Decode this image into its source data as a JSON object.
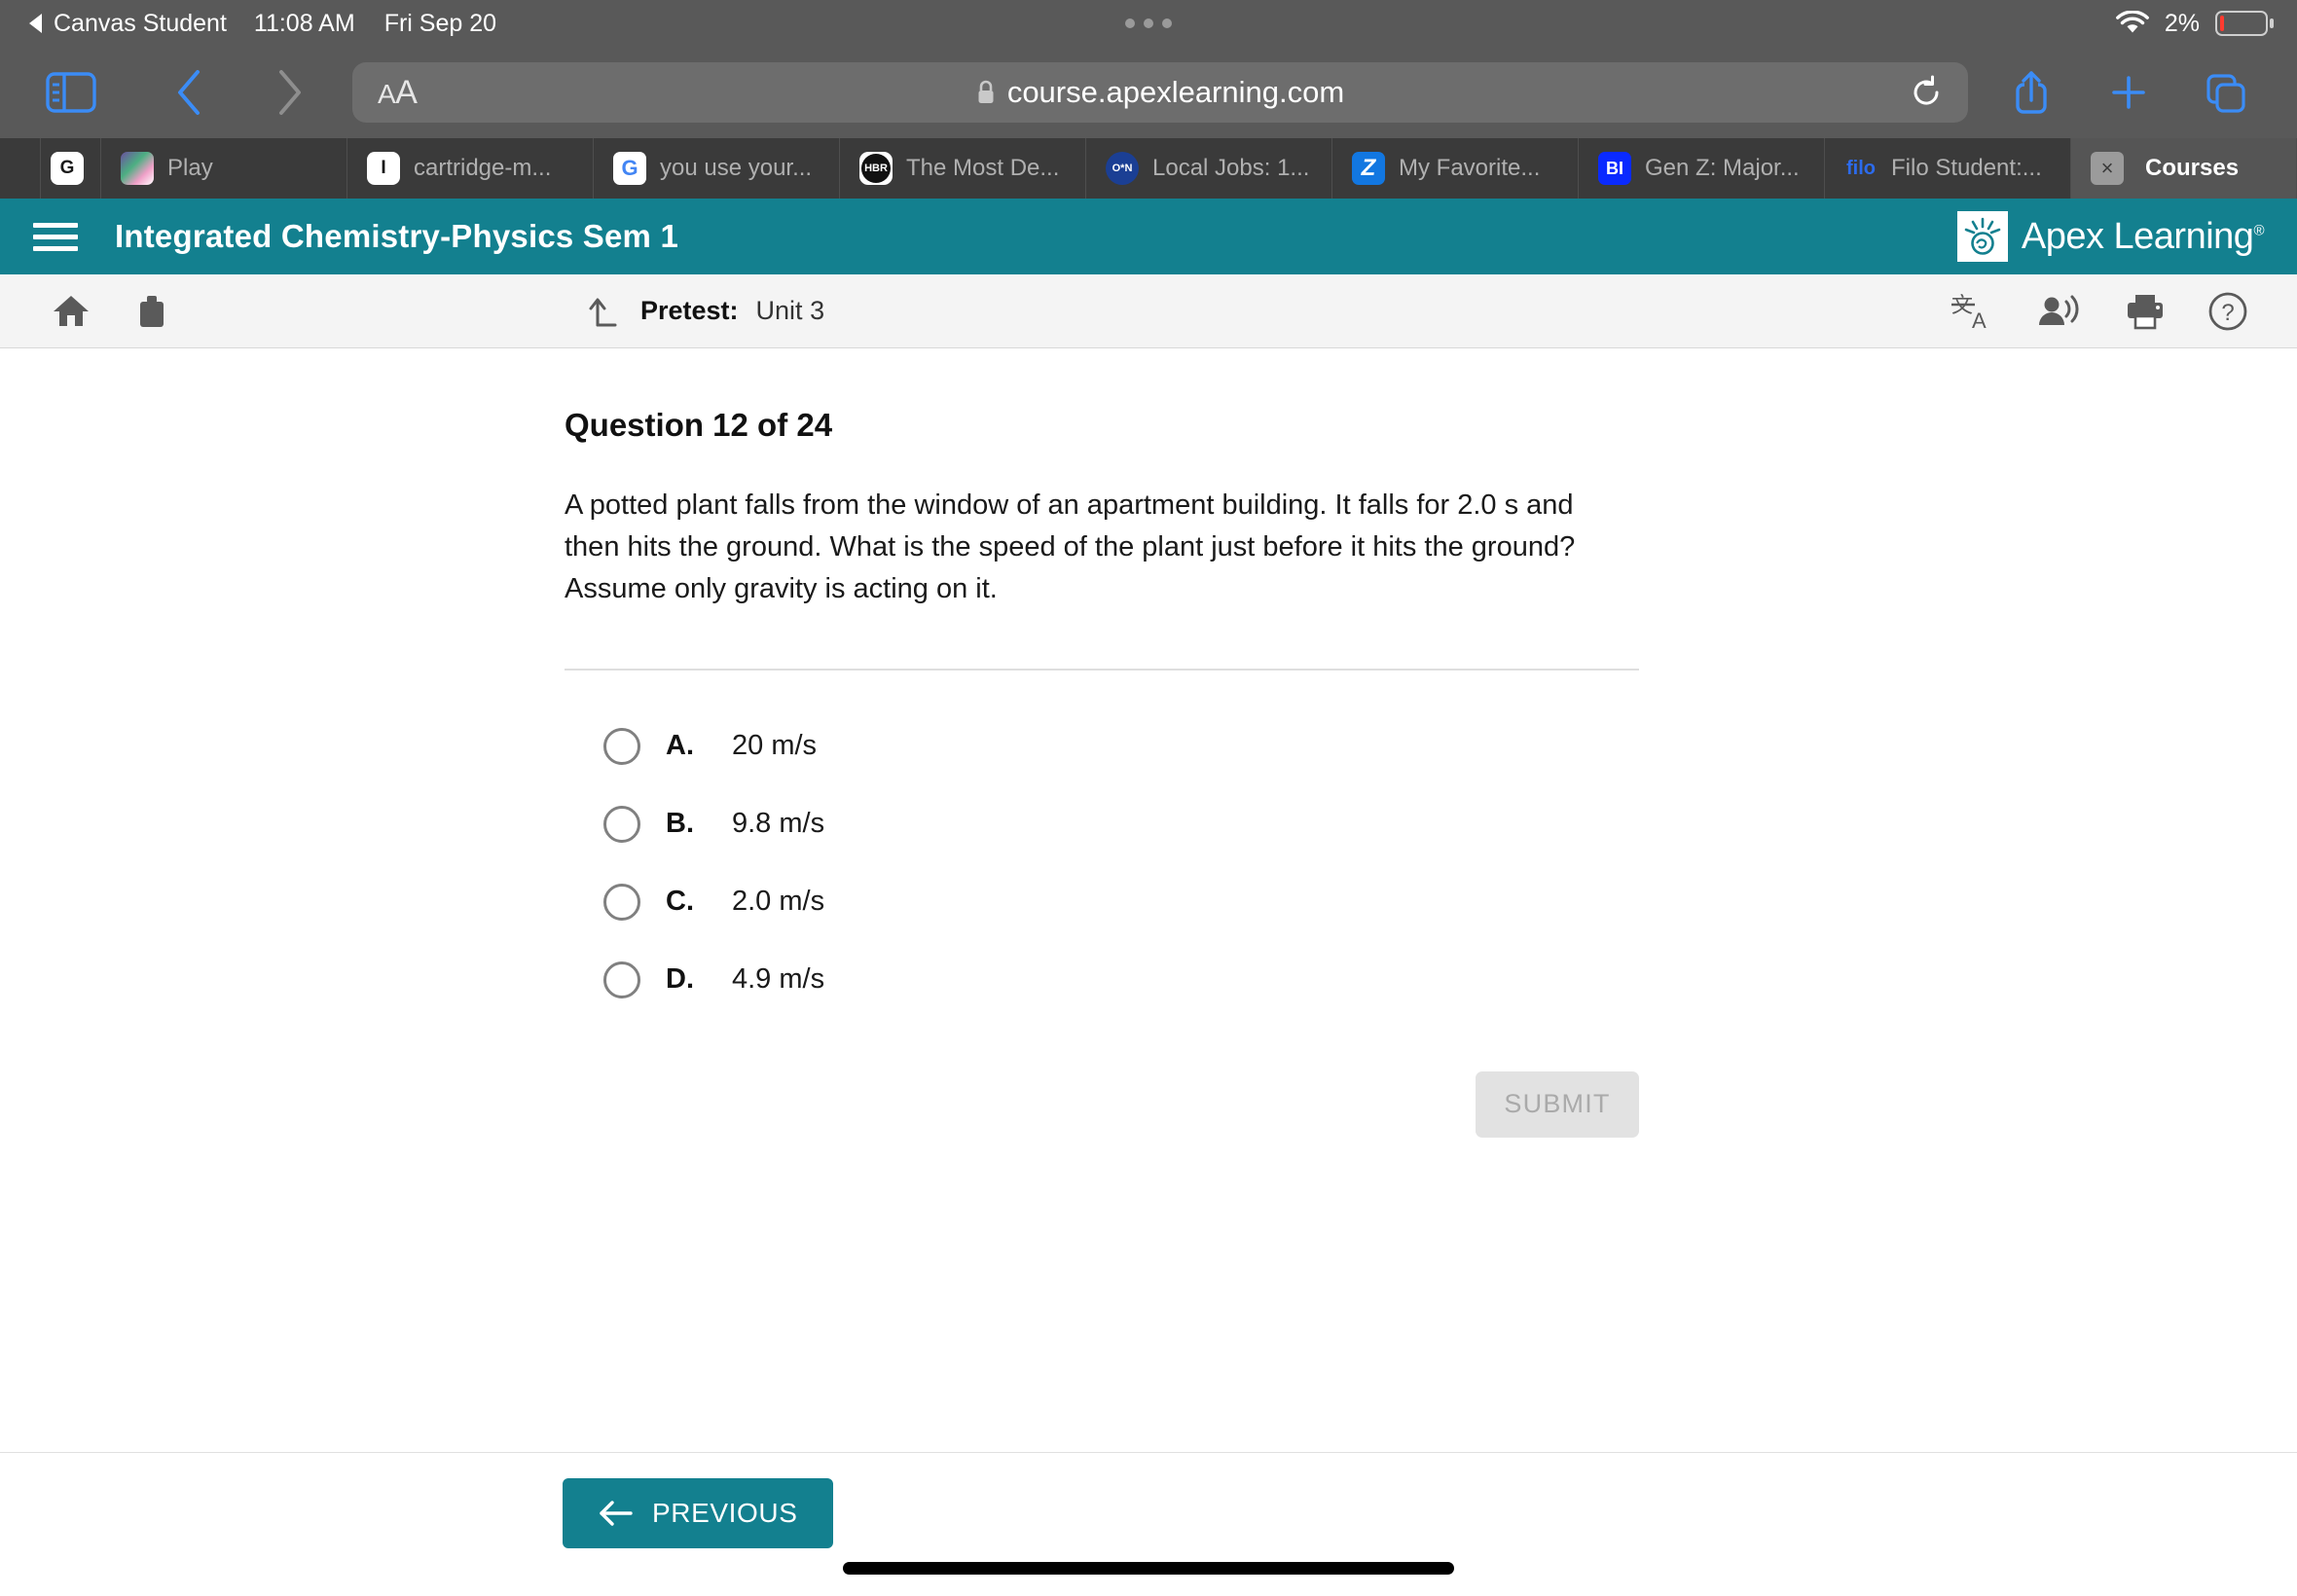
{
  "status_bar": {
    "back_app": "Canvas Student",
    "time": "11:08 AM",
    "date": "Fri Sep 20",
    "battery_percent": "2%",
    "wifi_icon": "wifi-icon",
    "battery_icon": "battery-low-icon"
  },
  "browser": {
    "sidebar_icon": "sidebar-toggle-icon",
    "back_icon": "chevron-left-icon",
    "forward_icon": "chevron-right-icon",
    "reader_label": "AA",
    "lock_icon": "lock-icon",
    "url": "course.apexlearning.com",
    "reload_icon": "reload-icon",
    "share_icon": "share-icon",
    "new_tab_icon": "plus-icon",
    "tabs_overview_icon": "tabs-overview-icon",
    "tabs": [
      {
        "title": "",
        "favicon": "blank-icon",
        "active": false,
        "width": "narrow"
      },
      {
        "title": "",
        "favicon": "g-icon",
        "active": false,
        "width": "tiny"
      },
      {
        "title": "Play",
        "favicon": "play-icon",
        "active": false,
        "width": "normal"
      },
      {
        "title": "cartridge-m...",
        "favicon": "i-icon",
        "active": false,
        "width": "normal"
      },
      {
        "title": "you use your...",
        "favicon": "google-icon",
        "active": false,
        "width": "normal"
      },
      {
        "title": "The Most De...",
        "favicon": "hbr-icon",
        "active": false,
        "width": "normal"
      },
      {
        "title": "Local Jobs: 1...",
        "favicon": "onet-icon",
        "active": false,
        "width": "normal"
      },
      {
        "title": "My Favorite...",
        "favicon": "zillow-icon",
        "active": false,
        "width": "normal"
      },
      {
        "title": "Gen Z: Major...",
        "favicon": "business-insider-icon",
        "active": false,
        "width": "normal"
      },
      {
        "title": "Filo Student:...",
        "favicon": "filo-icon",
        "active": false,
        "width": "normal"
      },
      {
        "title": "Courses",
        "favicon": "close-icon",
        "active": true,
        "width": "active"
      }
    ]
  },
  "app_header": {
    "menu_icon": "hamburger-menu-icon",
    "course_title": "Integrated Chemistry-Physics Sem 1",
    "logo_text": "Apex Learning",
    "logo_trademark": "®",
    "logo_mark": "apex-sunburst-icon",
    "brand_color": "#13808f"
  },
  "sub_toolbar": {
    "home_icon": "home-icon",
    "briefcase_icon": "briefcase-icon",
    "up_level_icon": "up-level-arrow-icon",
    "breadcrumb_label": "Pretest:",
    "breadcrumb_value": "Unit 3",
    "translate_icon": "translate-icon",
    "read-aloud_icon": "read-aloud-icon",
    "print_icon": "print-icon",
    "help_icon": "help-icon"
  },
  "question": {
    "heading": "Question 12 of 24",
    "current": 12,
    "total": 24,
    "text": "A potted plant falls from the window of an apartment building. It falls for 2.0 s and then hits the ground. What is the speed of the plant just before it hits the ground? Assume only gravity is acting on it.",
    "options": [
      {
        "letter": "A.",
        "text": "20 m/s",
        "selected": false
      },
      {
        "letter": "B.",
        "text": "9.8 m/s",
        "selected": false
      },
      {
        "letter": "C.",
        "text": "2.0 m/s",
        "selected": false
      },
      {
        "letter": "D.",
        "text": "4.9 m/s",
        "selected": false
      }
    ],
    "submit_label": "SUBMIT",
    "submit_disabled": true
  },
  "footer": {
    "previous_label": "PREVIOUS",
    "previous_icon": "arrow-left-icon"
  }
}
